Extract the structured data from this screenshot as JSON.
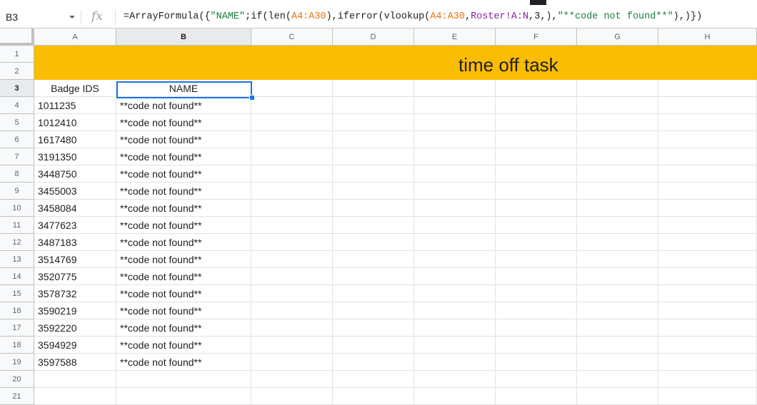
{
  "name_box": {
    "ref": "B3"
  },
  "formula_bar": {
    "fx_label": "fx",
    "segments": [
      {
        "t": "=ArrayFormula({",
        "c": "plain"
      },
      {
        "t": "\"NAME\"",
        "c": "str"
      },
      {
        "t": ";if(len(",
        "c": "plain"
      },
      {
        "t": "A4:A30",
        "c": "ref"
      },
      {
        "t": "),iferror(vlookup(",
        "c": "plain"
      },
      {
        "t": "A4:A30",
        "c": "ref"
      },
      {
        "t": ",",
        "c": "plain"
      },
      {
        "t": "Roster!A:N",
        "c": "ref2"
      },
      {
        "t": ",3,),",
        "c": "plain"
      },
      {
        "t": "\"**code not found**\"",
        "c": "str"
      },
      {
        "t": "),)})",
        "c": "plain"
      }
    ]
  },
  "columns": [
    "A",
    "B",
    "C",
    "D",
    "E",
    "F",
    "G",
    "H"
  ],
  "selected_column": "B",
  "selected_row": "3",
  "banner": {
    "title": "time off task",
    "color": "#fbbc04"
  },
  "headers": {
    "a": "Badge IDS",
    "b": "NAME"
  },
  "rows": [
    {
      "num": "4",
      "a": "1011235",
      "b": "**code not found**"
    },
    {
      "num": "5",
      "a": "1012410",
      "b": "**code not found**"
    },
    {
      "num": "6",
      "a": "1617480",
      "b": "**code not found**"
    },
    {
      "num": "7",
      "a": "3191350",
      "b": "**code not found**"
    },
    {
      "num": "8",
      "a": "3448750",
      "b": "**code not found**"
    },
    {
      "num": "9",
      "a": "3455003",
      "b": "**code not found**"
    },
    {
      "num": "10",
      "a": "3458084",
      "b": "**code not found**"
    },
    {
      "num": "11",
      "a": "3477623",
      "b": "**code not found**"
    },
    {
      "num": "12",
      "a": "3487183",
      "b": "**code not found**"
    },
    {
      "num": "13",
      "a": "3514769",
      "b": "**code not found**"
    },
    {
      "num": "14",
      "a": "3520775",
      "b": "**code not found**"
    },
    {
      "num": "15",
      "a": "3578732",
      "b": "**code not found**"
    },
    {
      "num": "16",
      "a": "3590219",
      "b": "**code not found**"
    },
    {
      "num": "17",
      "a": "3592220",
      "b": "**code not found**"
    },
    {
      "num": "18",
      "a": "3594929",
      "b": "**code not found**"
    },
    {
      "num": "19",
      "a": "3597588",
      "b": "**code not found**"
    },
    {
      "num": "20",
      "a": "",
      "b": ""
    },
    {
      "num": "21",
      "a": "",
      "b": ""
    }
  ],
  "top_rows": [
    "1",
    "2",
    "3"
  ],
  "colors": {
    "selection": "#1a73e8",
    "string": "#188038",
    "range": "#e8710a",
    "sheet_range": "#8b1fa8"
  }
}
